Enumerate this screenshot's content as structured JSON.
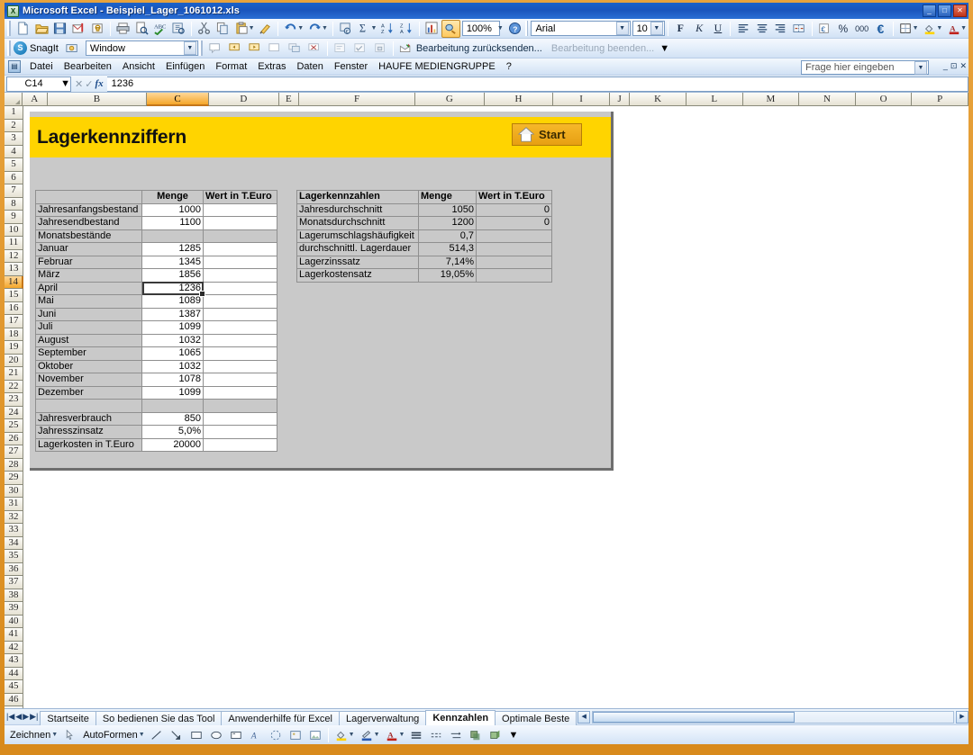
{
  "window": {
    "title": "Microsoft Excel - Beispiel_Lager_1061012.xls",
    "app_icon": "excel-icon",
    "minimize": "_",
    "restore": "□",
    "close": "✕"
  },
  "menu": {
    "items": [
      "Datei",
      "Bearbeiten",
      "Ansicht",
      "Einfügen",
      "Format",
      "Extras",
      "Daten",
      "Fenster",
      "HAUFE MEDIENGRUPPE",
      "?"
    ],
    "ask_placeholder": "Frage hier eingeben",
    "doc_minimize": "_",
    "doc_restore": "⊡",
    "doc_close": "✕"
  },
  "toolbar": {
    "zoom_value": "100%",
    "font_name": "Arial",
    "font_size": "10",
    "bold_label": "F",
    "italic_label": "K",
    "underline_label": "U",
    "currency_label": "€",
    "percent_label": "%",
    "thousands_label": "000",
    "icons": [
      "new-icon",
      "open-icon",
      "save-icon",
      "mail-icon",
      "permission-icon",
      "print-icon",
      "print-preview-icon",
      "spelling-icon",
      "research-icon",
      "cut-icon",
      "copy-icon",
      "paste-icon",
      "format-painter-icon",
      "undo-icon",
      "redo-icon",
      "hyperlink-icon",
      "autosum-icon",
      "sort-asc-icon",
      "sort-desc-icon",
      "chart-icon",
      "drawing-icon",
      "help-icon"
    ]
  },
  "snagit_bar": {
    "label": "SnagIt",
    "profile_value": "Window"
  },
  "review_bar": {
    "send_back_label": "Bearbeitung zurücksenden...",
    "finish_label": "Bearbeitung beenden..."
  },
  "formula_bar": {
    "name_box": "C14",
    "cancel_icon": "cancel-icon",
    "accept_icon": "accept-icon",
    "function_icon": "fx",
    "value": "1236"
  },
  "grid": {
    "columns": [
      "A",
      "B",
      "C",
      "D",
      "E",
      "F",
      "G",
      "H",
      "I",
      "J",
      "K",
      "L",
      "M",
      "N",
      "O",
      "P"
    ],
    "selected_column": "C",
    "selected_row": 14,
    "row_count": 48,
    "first_row": 1
  },
  "sheet": {
    "banner_title": "Lagerkennziffern",
    "start_button": "Start",
    "start_icon": "home-icon",
    "left_table": {
      "headers": [
        "",
        "Menge",
        "Wert in T.Euro"
      ],
      "rows": [
        {
          "label": "Jahresanfangsbestand",
          "menge": "1000",
          "wert": "",
          "type": "data"
        },
        {
          "label": "Jahresendbestand",
          "menge": "1100",
          "wert": "",
          "type": "data"
        },
        {
          "label": "Monatsbestände",
          "menge": "",
          "wert": "",
          "type": "section"
        },
        {
          "label": "Januar",
          "menge": "1285",
          "wert": "",
          "type": "data"
        },
        {
          "label": "Februar",
          "menge": "1345",
          "wert": "",
          "type": "data"
        },
        {
          "label": "März",
          "menge": "1856",
          "wert": "",
          "type": "data"
        },
        {
          "label": "April",
          "menge": "1236",
          "wert": "",
          "type": "selected"
        },
        {
          "label": "Mai",
          "menge": "1089",
          "wert": "",
          "type": "data"
        },
        {
          "label": "Juni",
          "menge": "1387",
          "wert": "",
          "type": "data"
        },
        {
          "label": "Juli",
          "menge": "1099",
          "wert": "",
          "type": "data"
        },
        {
          "label": "August",
          "menge": "1032",
          "wert": "",
          "type": "data"
        },
        {
          "label": "September",
          "menge": "1065",
          "wert": "",
          "type": "data"
        },
        {
          "label": "Oktober",
          "menge": "1032",
          "wert": "",
          "type": "data"
        },
        {
          "label": "November",
          "menge": "1078",
          "wert": "",
          "type": "data"
        },
        {
          "label": "Dezember",
          "menge": "1099",
          "wert": "",
          "type": "data"
        },
        {
          "label": "",
          "menge": "",
          "wert": "",
          "type": "section"
        },
        {
          "label": "Jahresverbrauch",
          "menge": "850",
          "wert": "",
          "type": "data"
        },
        {
          "label": "Jahresszinsatz",
          "menge": "5,0%",
          "wert": "",
          "type": "data"
        },
        {
          "label": "Lagerkosten in T.Euro",
          "menge": "20000",
          "wert": "",
          "type": "data"
        }
      ]
    },
    "right_table": {
      "headers": [
        "Lagerkennzahlen",
        "Menge",
        "Wert in T.Euro"
      ],
      "rows": [
        {
          "label": "Jahresdurchschnitt",
          "menge": "1050",
          "wert": "0"
        },
        {
          "label": "Monatsdurchschnitt",
          "menge": "1200",
          "wert": "0"
        },
        {
          "label": "Lagerumschlagshäufigkeit",
          "menge": "0,7",
          "wert": ""
        },
        {
          "label": "durchschnittl. Lagerdauer",
          "menge": "514,3",
          "wert": ""
        },
        {
          "label": "Lagerzinssatz",
          "menge": "7,14%",
          "wert": ""
        },
        {
          "label": "Lagerkostensatz",
          "menge": "19,05%",
          "wert": ""
        }
      ]
    }
  },
  "sheet_tabs": {
    "first_icon": "first-sheet-icon",
    "prev_icon": "prev-sheet-icon",
    "next_icon": "next-sheet-icon",
    "last_icon": "last-sheet-icon",
    "tabs": [
      {
        "label": "Startseite",
        "active": false
      },
      {
        "label": "So bedienen Sie das Tool",
        "active": false
      },
      {
        "label": "Anwenderhilfe für Excel",
        "active": false
      },
      {
        "label": "Lagerverwaltung",
        "active": false
      },
      {
        "label": "Kennzahlen",
        "active": true
      },
      {
        "label": "Optimale Beste",
        "active": false
      }
    ]
  },
  "drawing_bar": {
    "draw_label": "Zeichnen",
    "autoshapes_label": "AutoFormen",
    "tools": [
      "line-icon",
      "arrow-icon",
      "rectangle-icon",
      "oval-icon",
      "textbox-icon",
      "wordart-icon",
      "diagram-icon",
      "clipart-icon",
      "picture-icon",
      "fill-color-icon",
      "line-color-icon",
      "font-color-icon",
      "line-style-icon",
      "dash-style-icon",
      "arrow-style-icon",
      "shadow-icon",
      "3d-icon"
    ]
  },
  "colors": {
    "banner_yellow": "#ffd400",
    "panel_grey": "#c9c9c9",
    "selection_orange": "#f4a62a",
    "frame_orange": "#d88a1c",
    "title_blue": "#1a55bd"
  }
}
